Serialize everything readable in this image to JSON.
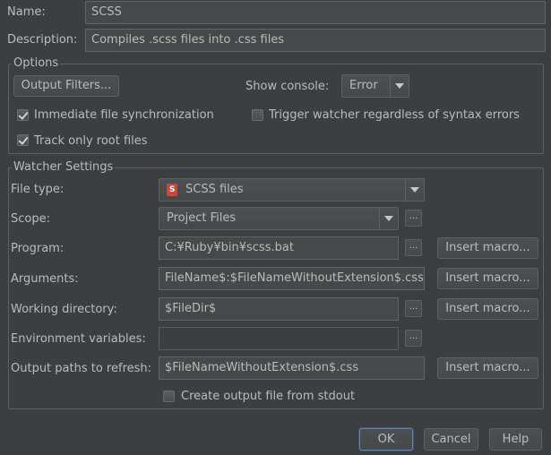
{
  "name": {
    "label": "Name:",
    "value": "SCSS"
  },
  "description": {
    "label": "Description:",
    "value": "Compiles .scss files into .css files"
  },
  "options": {
    "title": "Options",
    "output_filters_button": "Output Filters...",
    "show_console_label": "Show console:",
    "show_console_value": "Error",
    "immediate_sync": {
      "label": "Immediate file synchronization",
      "checked": true
    },
    "trigger_watcher": {
      "label": "Trigger watcher regardless of syntax errors",
      "checked": false
    },
    "track_root": {
      "label": "Track only root files",
      "checked": true
    }
  },
  "watcher": {
    "title": "Watcher Settings",
    "file_type": {
      "label": "File type:",
      "value": "SCSS files",
      "icon": "scss-file-icon"
    },
    "scope": {
      "label": "Scope:",
      "value": "Project Files",
      "browse": "..."
    },
    "program": {
      "label": "Program:",
      "value": "C:¥Ruby¥bin¥scss.bat",
      "browse": "...",
      "macro": "Insert macro..."
    },
    "arguments": {
      "label": "Arguments:",
      "value": "FileName$:$FileNameWithoutExtension$.css",
      "macro": "Insert macro..."
    },
    "working_dir": {
      "label": "Working directory:",
      "value": "$FileDir$",
      "browse": "...",
      "macro": "Insert macro..."
    },
    "env_vars": {
      "label": "Environment variables:",
      "value": "",
      "browse": "..."
    },
    "output_paths": {
      "label": "Output paths to refresh:",
      "value": "$FileNameWithoutExtension$.css",
      "macro": "Insert macro..."
    },
    "stdout": {
      "label": "Create output file from stdout",
      "checked": false
    }
  },
  "footer": {
    "ok": "OK",
    "cancel": "Cancel",
    "help": "Help"
  },
  "colors": {
    "background": "#3c3f41",
    "field": "#45494a",
    "text": "#bbbbbb",
    "default_button_border": "#6b85a8",
    "file_icon": "#c9483a"
  }
}
